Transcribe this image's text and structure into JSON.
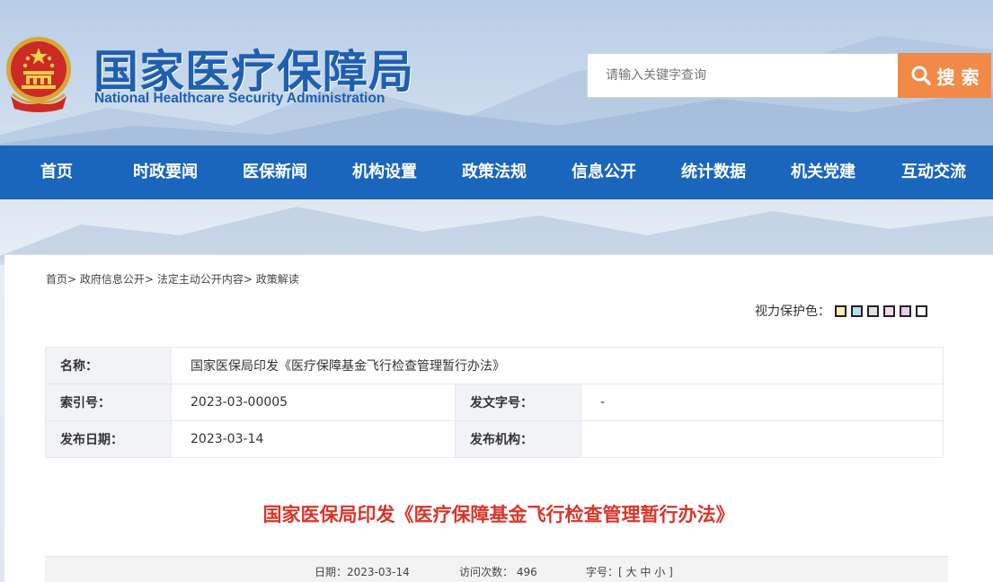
{
  "header": {
    "title_cn": "国家医疗保障局",
    "title_en": "National Healthcare Security Administration"
  },
  "search": {
    "placeholder": "请输入关键字查询",
    "button_label": "搜 索",
    "icon": "search-icon"
  },
  "nav": {
    "items": [
      "首页",
      "时政要闻",
      "医保新闻",
      "机构设置",
      "政策法规",
      "信息公开",
      "统计数据",
      "机关党建",
      "互动交流"
    ]
  },
  "breadcrumb": {
    "items": [
      "首页",
      "政府信息公开",
      "法定主动公开内容",
      "政策解读"
    ],
    "sep": ">"
  },
  "eye_protect": {
    "label": "视力保护色：",
    "colors": [
      "#f7eeb0",
      "#b5def0",
      "#e2e2e2",
      "#f4d6ea",
      "#e3cdf0",
      "#ffffff"
    ]
  },
  "meta": {
    "name_label": "名称：",
    "name_value": "国家医保局印发《医疗保障基金飞行检查管理暂行办法》",
    "index_label": "索引号：",
    "index_value": "2023-03-00005",
    "doc_no_label": "发文字号：",
    "doc_no_value": "-",
    "date_label": "发布日期：",
    "date_value": "2023-03-14",
    "org_label": "发布机构：",
    "org_value": ""
  },
  "article": {
    "title": "国家医保局印发《医疗保障基金飞行检查管理暂行办法》"
  },
  "infobar": {
    "date_label": "日期：",
    "date_value": "2023-03-14",
    "visits_label": "访问次数：",
    "visits_value": "496",
    "font_label": "字号：",
    "bracket_open": "[",
    "font_large": "大",
    "font_medium": "中",
    "font_small": "小",
    "bracket_close": "]"
  },
  "colors": {
    "nav_bg": "#1a66bc",
    "search_btn": "#f08a46",
    "title_red": "#d9352a",
    "brand_blue": "#1f5fb0"
  }
}
